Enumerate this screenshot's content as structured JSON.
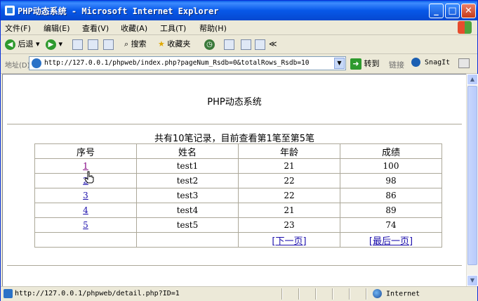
{
  "window": {
    "title": "PHP动态系统 - Microsoft Internet Explorer",
    "controls": {
      "minimize": "_",
      "maximize": "□",
      "close": "✕"
    }
  },
  "menubar": {
    "items": [
      {
        "label": "文件(F)"
      },
      {
        "label": "编辑(E)"
      },
      {
        "label": "查看(V)"
      },
      {
        "label": "收藏(A)"
      },
      {
        "label": "工具(T)"
      },
      {
        "label": "帮助(H)"
      }
    ]
  },
  "toolbar": {
    "back_label": "后退",
    "search_label": "搜索",
    "favorites_label": "收藏夹"
  },
  "addressbar": {
    "label": "地址(D)",
    "url": "http://127.0.0.1/phpweb/index.php?pageNum_Rsdb=0&totalRows_Rsdb=10",
    "go_label": "转到",
    "links_label": "链接",
    "snagit_label": "SnagIt"
  },
  "page": {
    "title": "PHP动态系统",
    "summary": "共有10笔记录，目前查看第1笔至第5笔",
    "table": {
      "headers": [
        "序号",
        "姓名",
        "年龄",
        "成绩"
      ],
      "rows": [
        {
          "id": "1",
          "name": "test1",
          "age": "21",
          "score": "100"
        },
        {
          "id": "2",
          "name": "test2",
          "age": "22",
          "score": "98"
        },
        {
          "id": "3",
          "name": "test3",
          "age": "22",
          "score": "86"
        },
        {
          "id": "4",
          "name": "test4",
          "age": "21",
          "score": "89"
        },
        {
          "id": "5",
          "name": "test5",
          "age": "23",
          "score": "74"
        }
      ]
    },
    "pager": {
      "next": "[下一页]",
      "last": "[最后一页]"
    }
  },
  "statusbar": {
    "text": "http://127.0.0.1/phpweb/detail.php?ID=1",
    "zone": "Internet"
  },
  "colors": {
    "title_blue": "#0758e8",
    "link": "#1a0dab",
    "visited_link": "#800080"
  }
}
